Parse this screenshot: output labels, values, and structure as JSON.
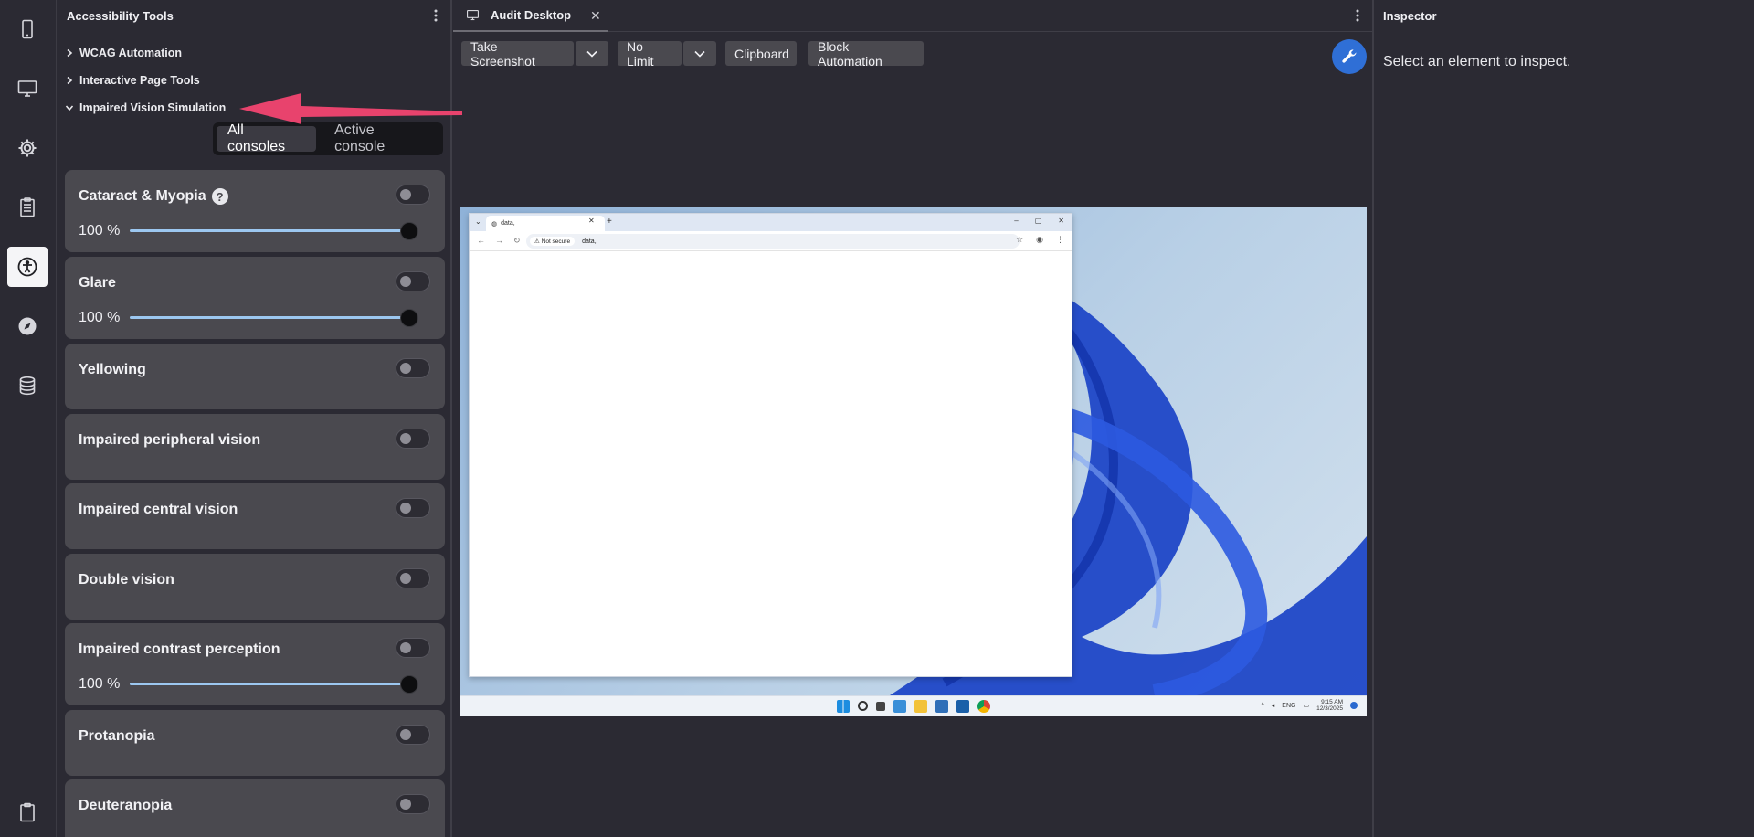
{
  "left_panel": {
    "title": "Accessibility Tools",
    "tree": [
      {
        "label": "WCAG Automation",
        "expanded": false
      },
      {
        "label": "Interactive Page Tools",
        "expanded": false
      },
      {
        "label": "Impaired Vision Simulation",
        "expanded": true
      }
    ],
    "segmented": {
      "options": [
        "All consoles",
        "Active console"
      ],
      "selected": "All consoles"
    },
    "cards": [
      {
        "title": "Cataract & Myopia",
        "help": "?",
        "enabled": false,
        "percent_label": "100 %",
        "value": 100
      },
      {
        "title": "Glare",
        "enabled": false,
        "percent_label": "100 %",
        "value": 100
      },
      {
        "title": "Yellowing",
        "enabled": false
      },
      {
        "title": "Impaired peripheral vision",
        "enabled": false
      },
      {
        "title": "Impaired central vision",
        "enabled": false
      },
      {
        "title": "Double vision",
        "enabled": false
      },
      {
        "title": "Impaired contrast perception",
        "enabled": false,
        "percent_label": "100 %",
        "value": 100
      },
      {
        "title": "Protanopia",
        "enabled": false
      },
      {
        "title": "Deuteranopia",
        "enabled": false
      }
    ]
  },
  "center": {
    "tab": {
      "label": "Audit Desktop",
      "close": "✕"
    },
    "toolbar": {
      "screenshot": "Take Screenshot",
      "limit": "No Limit",
      "clipboard": "Clipboard",
      "block": "Block Automation"
    },
    "browser": {
      "tab_title": "data,",
      "tab_close": "✕",
      "new_tab": "+",
      "not_secure": "Not secure",
      "url": "data,"
    },
    "taskbar": {
      "lang": "ENG",
      "time": "9:15 AM",
      "date": "12/3/2025"
    }
  },
  "inspector": {
    "title": "Inspector",
    "message": "Select an element to inspect."
  },
  "colors": {
    "bg": "#2b2a33",
    "card": "#4a494f",
    "accent_blue": "#2f6fd6",
    "slider": "#9cc7f0",
    "annotation_arrow": "#e8436d"
  }
}
